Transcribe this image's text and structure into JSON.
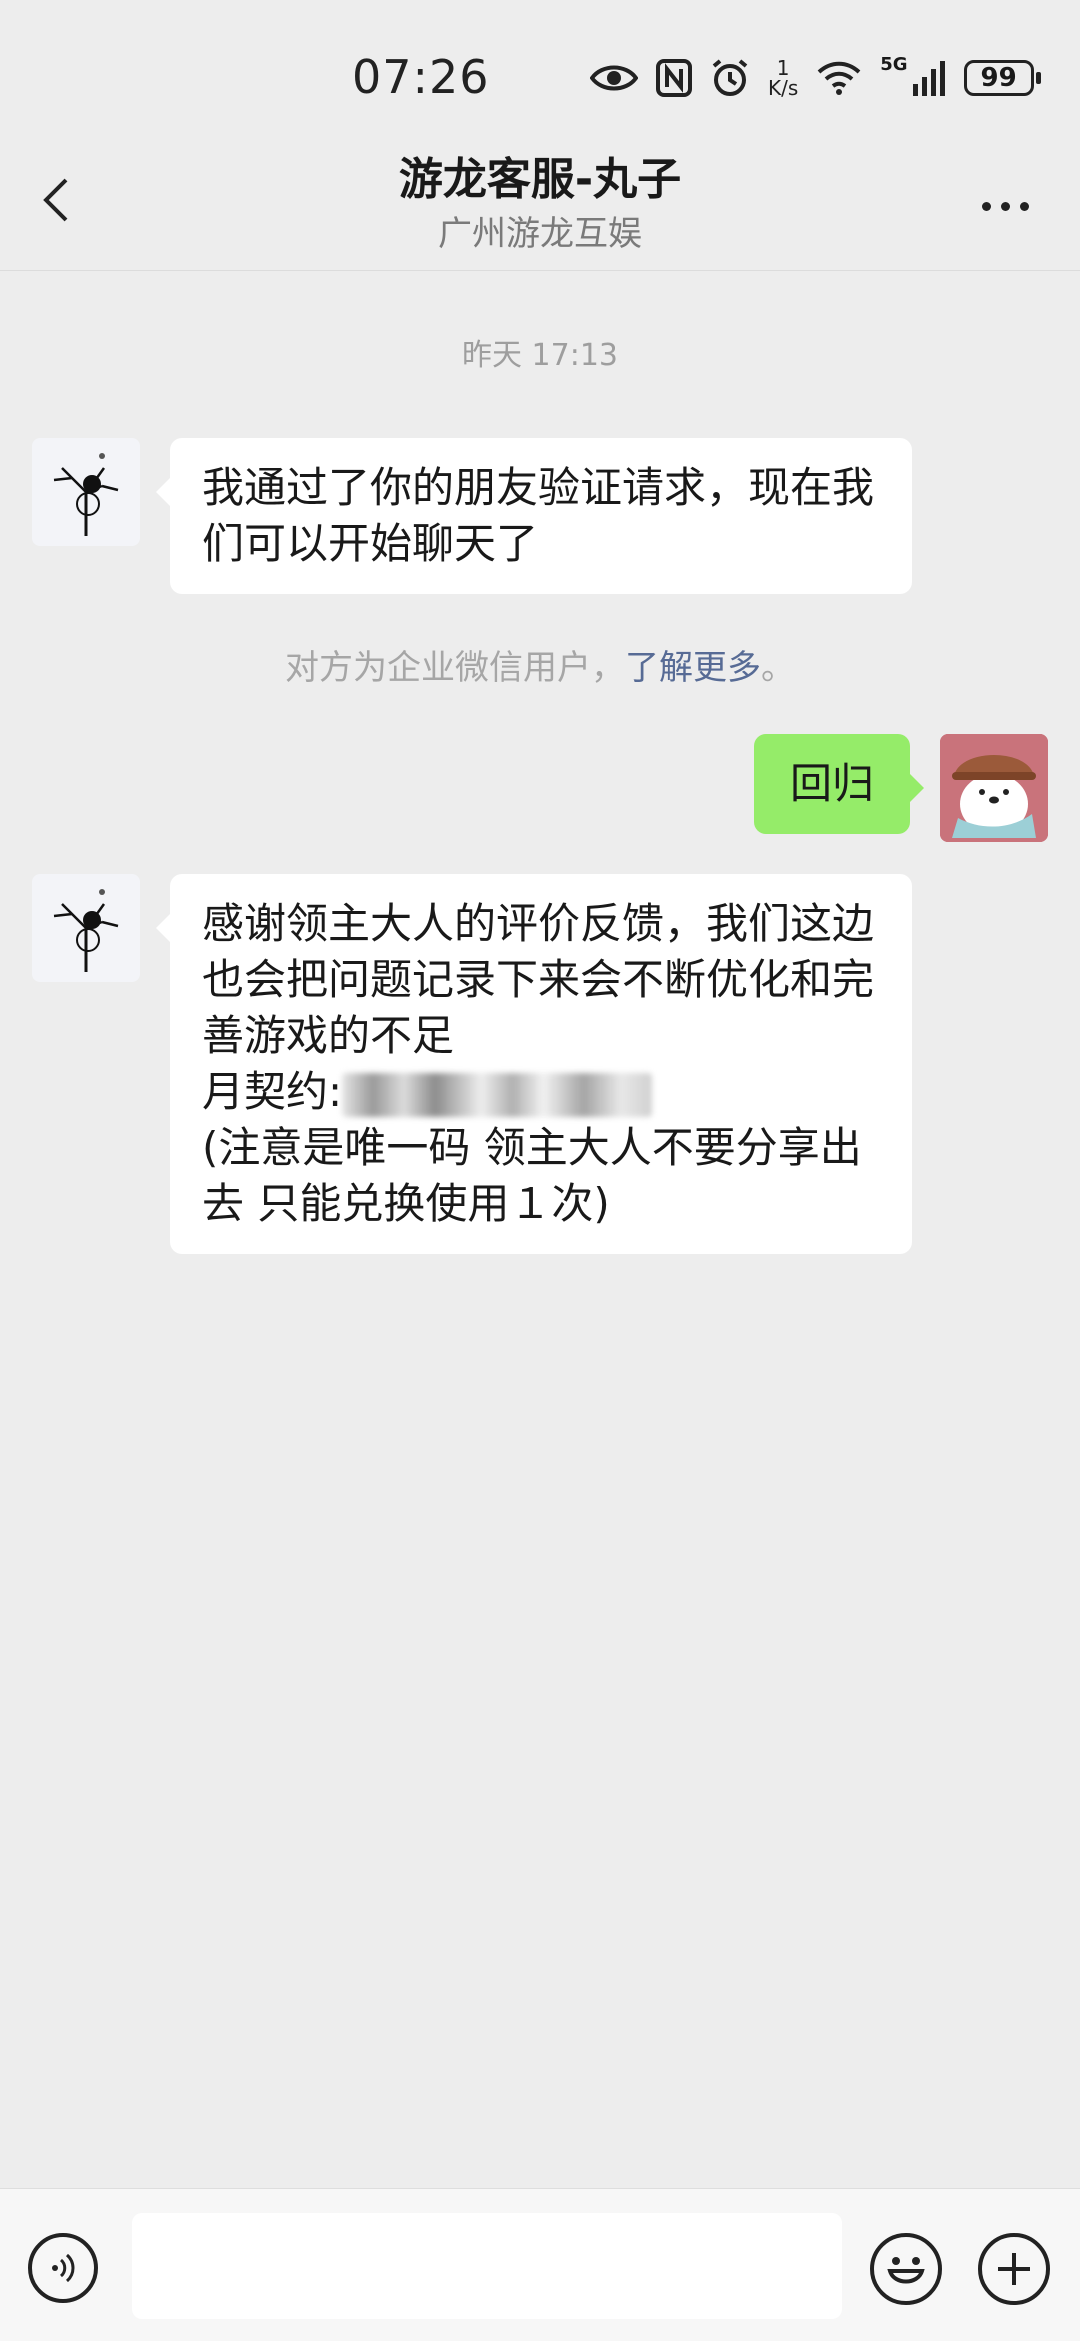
{
  "status_bar": {
    "time": "07:26",
    "net_speed_value": "1",
    "net_speed_unit": "K/s",
    "network": "5G",
    "battery": "99"
  },
  "header": {
    "title": "游龙客服-丸子",
    "subtitle": "广州游龙互娱"
  },
  "messages": {
    "timestamp": "昨天 17:13",
    "msg1": "我通过了你的朋友验证请求，现在我们可以开始聊天了",
    "system_note_text": "对方为企业微信用户，",
    "system_note_link": "了解更多",
    "system_note_end": "。",
    "msg2": "回归",
    "msg3_line1": "感谢领主大人的评价反馈，我们这边也会把问题记录下来会不断优化和完善游戏的不足",
    "msg3_code_label": "月契约:",
    "msg3_line3": "(注意是唯一码 领主大人不要分享出去 只能兑换使用１次)"
  },
  "input_bar": {
    "placeholder": ""
  },
  "icons": {
    "back": "back-arrow-icon",
    "more": "more-dots-icon",
    "voice": "voice-icon",
    "emoji": "emoji-icon",
    "plus": "plus-icon",
    "eye": "eye-icon",
    "nfc": "nfc-icon",
    "alarm": "alarm-icon",
    "wifi": "wifi-icon",
    "signal": "signal-icon"
  },
  "colors": {
    "background": "#ededed",
    "bubble_self": "#95ec69",
    "bubble_other": "#ffffff",
    "link": "#576b95"
  }
}
